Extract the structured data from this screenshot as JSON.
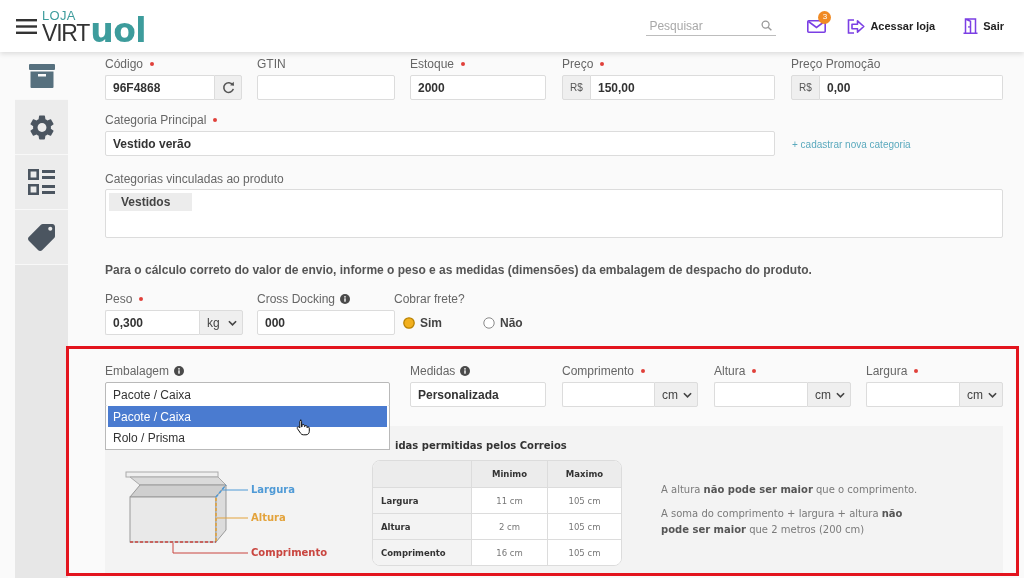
{
  "header": {
    "logo": {
      "caption": "LOJA",
      "wordmark": "VIRT",
      "brand": "uol"
    },
    "search": {
      "placeholder": "Pesquisar"
    },
    "mail": {
      "badge": "3"
    },
    "actions": [
      {
        "kind": "enter",
        "label": "Acessar loja"
      },
      {
        "kind": "exit",
        "label": "Sair"
      }
    ]
  },
  "sidebar": {
    "tabs": [
      {
        "kind": "archive",
        "selected": true
      },
      {
        "kind": "gear",
        "selected": false
      },
      {
        "kind": "list",
        "selected": false
      },
      {
        "kind": "tag",
        "selected": false
      }
    ]
  },
  "product_row": [
    {
      "kind": "text_refresh",
      "label": "Código",
      "required": true,
      "info": false,
      "value": "96F4868"
    },
    {
      "kind": "text",
      "label": "GTIN",
      "required": false,
      "info": false
    },
    {
      "kind": "text",
      "label": "Estoque",
      "required": true,
      "info": false,
      "value": "2000"
    },
    {
      "kind": "prefixed",
      "label": "Preço",
      "required": true,
      "info": false,
      "prefix": "R$",
      "value": "150,00"
    },
    {
      "kind": "prefixed",
      "label": "Preço Promoção",
      "required": false,
      "info": false,
      "prefix": "R$",
      "value": "0,00"
    }
  ],
  "main_category": {
    "label": "Categoria Principal",
    "required": true,
    "value": "Vestido verão",
    "link": "+ cadastrar nova categoria"
  },
  "linked_categories": {
    "label": "Categorias vinculadas ao produto",
    "tags": [
      "Vestidos"
    ]
  },
  "shipping_note": "Para o cálculo correto do valor de envio, informe o peso e as medidas (dimensões) da embalagem de despacho do produto.",
  "shipping_row": [
    {
      "kind": "unit",
      "label": "Peso",
      "required": true,
      "info": false,
      "value": "0,300",
      "unit": "kg"
    },
    {
      "kind": "text",
      "label": "Cross Docking",
      "required": false,
      "info": true,
      "value": "000"
    },
    {
      "kind": "radio",
      "label": "Cobrar frete?",
      "required": false,
      "info": false,
      "options": [
        {
          "label": "Sim",
          "selected": true
        },
        {
          "label": "Não",
          "selected": false
        }
      ]
    }
  ],
  "packaging": {
    "highlighted": true,
    "fields": [
      {
        "kind": "dropdown",
        "label": "Embalagem",
        "required": false,
        "info": true,
        "value": "Pacote / Caixa",
        "expanded": true,
        "options": [
          {
            "label": "Pacote / Caixa",
            "selected": true
          },
          {
            "label": "Rolo / Prisma",
            "selected": false
          }
        ]
      },
      {
        "kind": "text",
        "label": "Medidas",
        "required": false,
        "info": true,
        "value": "Personalizada"
      },
      {
        "kind": "unit",
        "label": "Comprimento",
        "required": true,
        "info": false,
        "unit": "cm"
      },
      {
        "kind": "unit",
        "label": "Altura",
        "required": true,
        "info": false,
        "unit": "cm"
      },
      {
        "kind": "unit",
        "label": "Largura",
        "required": true,
        "info": false,
        "unit": "cm"
      }
    ],
    "panel": {
      "table_title": "idas permitidas pelos Correios",
      "diagram_labels": [
        {
          "text": "Largura",
          "color": "#4f9ad6"
        },
        {
          "text": "Altura",
          "color": "#e3a33c"
        },
        {
          "text": "Comprimento",
          "color": "#c9453f"
        }
      ],
      "table": {
        "columns": [
          "Minimo",
          "Maximo"
        ],
        "rows": [
          {
            "label": "Largura",
            "cells": [
              "11 cm",
              "105 cm"
            ]
          },
          {
            "label": "Altura",
            "cells": [
              "2 cm",
              "105 cm"
            ]
          },
          {
            "label": "Comprimento",
            "cells": [
              "16 cm",
              "105 cm"
            ]
          }
        ]
      },
      "rules": [
        "A altura **não pode ser maior** que o comprimento.",
        "A soma do comprimento + largura + altura **não pode ser maior** que 2 metros (200 cm)"
      ]
    }
  }
}
